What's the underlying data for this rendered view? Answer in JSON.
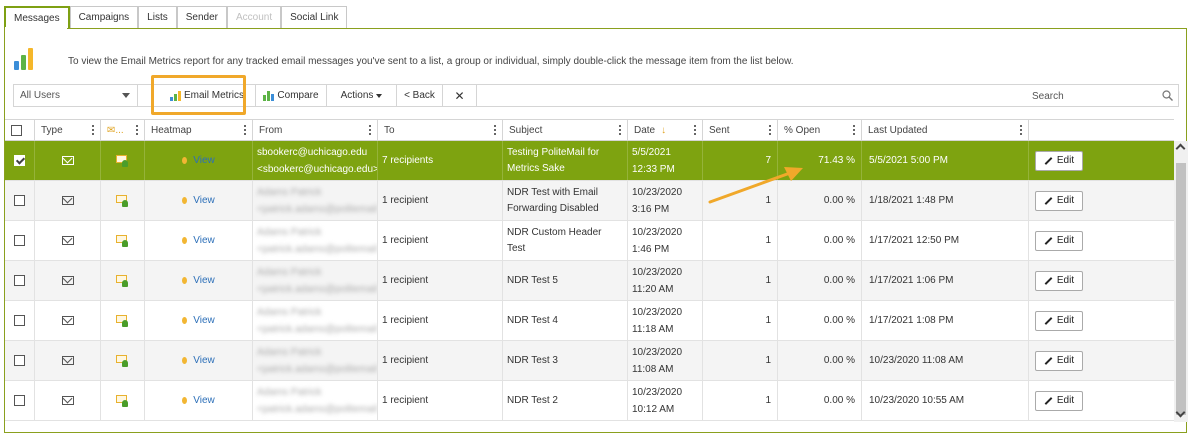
{
  "tabs": [
    "Messages",
    "Campaigns",
    "Lists",
    "Sender",
    "Account",
    "Social Link"
  ],
  "info_text": "To view the Email Metrics report for any tracked email messages you've sent to a list, a group or individual, simply double-click the message item from the list below.",
  "toolbar": {
    "filter_value": "All Users",
    "email_metrics_label": "Email Metrics",
    "compare_label": "Compare",
    "actions_label": "Actions",
    "back_label": "< Back",
    "close_label": "✕",
    "search_label": "Search"
  },
  "columns": {
    "type": "Type",
    "tracking": "✉...",
    "heatmap": "Heatmap",
    "from": "From",
    "to": "To",
    "subject": "Subject",
    "date": "Date",
    "sent": "Sent",
    "open": "% Open",
    "updated": "Last Updated"
  },
  "rows": [
    {
      "from1": "sbookerc@uchicago.edu",
      "from2": "<sbookerc@uchicago.edu>",
      "to": "7 recipients",
      "subject": "Testing PoliteMail for Metrics Sake",
      "date1": "5/5/2021",
      "date2": "12:33 PM",
      "sent": "7",
      "open": "71.43 %",
      "updated": "5/5/2021 5:00 PM",
      "view": "View",
      "edit": "Edit"
    },
    {
      "from1": "Adams Patrick",
      "from2": "<patrick.adams@politemail",
      "to": "1 recipient",
      "subject": "NDR Test with Email Forwarding Disabled",
      "date1": "10/23/2020",
      "date2": "3:16 PM",
      "sent": "1",
      "open": "0.00 %",
      "updated": "1/18/2021 1:48 PM",
      "view": "View",
      "edit": "Edit"
    },
    {
      "from1": "Adams Patrick",
      "from2": "<patrick.adams@politemail",
      "to": "1 recipient",
      "subject": "NDR Custom Header Test",
      "date1": "10/23/2020",
      "date2": "1:46 PM",
      "sent": "1",
      "open": "0.00 %",
      "updated": "1/17/2021 12:50 PM",
      "view": "View",
      "edit": "Edit"
    },
    {
      "from1": "Adams Patrick",
      "from2": "<patrick.adams@politemail",
      "to": "1 recipient",
      "subject": "NDR Test 5",
      "date1": "10/23/2020",
      "date2": "11:20 AM",
      "sent": "1",
      "open": "0.00 %",
      "updated": "1/17/2021 1:06 PM",
      "view": "View",
      "edit": "Edit"
    },
    {
      "from1": "Adams Patrick",
      "from2": "<patrick.adams@politemail",
      "to": "1 recipient",
      "subject": "NDR Test 4",
      "date1": "10/23/2020",
      "date2": "11:18 AM",
      "sent": "1",
      "open": "0.00 %",
      "updated": "1/17/2021 1:08 PM",
      "view": "View",
      "edit": "Edit"
    },
    {
      "from1": "Adams Patrick",
      "from2": "<patrick.adams@politemail",
      "to": "1 recipient",
      "subject": "NDR Test 3",
      "date1": "10/23/2020",
      "date2": "11:08 AM",
      "sent": "1",
      "open": "0.00 %",
      "updated": "10/23/2020 11:08 AM",
      "view": "View",
      "edit": "Edit"
    },
    {
      "from1": "Adams Patrick",
      "from2": "<patrick.adams@politemail",
      "to": "1 recipient",
      "subject": "NDR Test 2",
      "date1": "10/23/2020",
      "date2": "10:12 AM",
      "sent": "1",
      "open": "0.00 %",
      "updated": "10/23/2020 10:55 AM",
      "view": "View",
      "edit": "Edit"
    }
  ],
  "colors": {
    "accent": "#7ea310",
    "highlight": "#f0a82a",
    "link": "#2c6fb8"
  }
}
